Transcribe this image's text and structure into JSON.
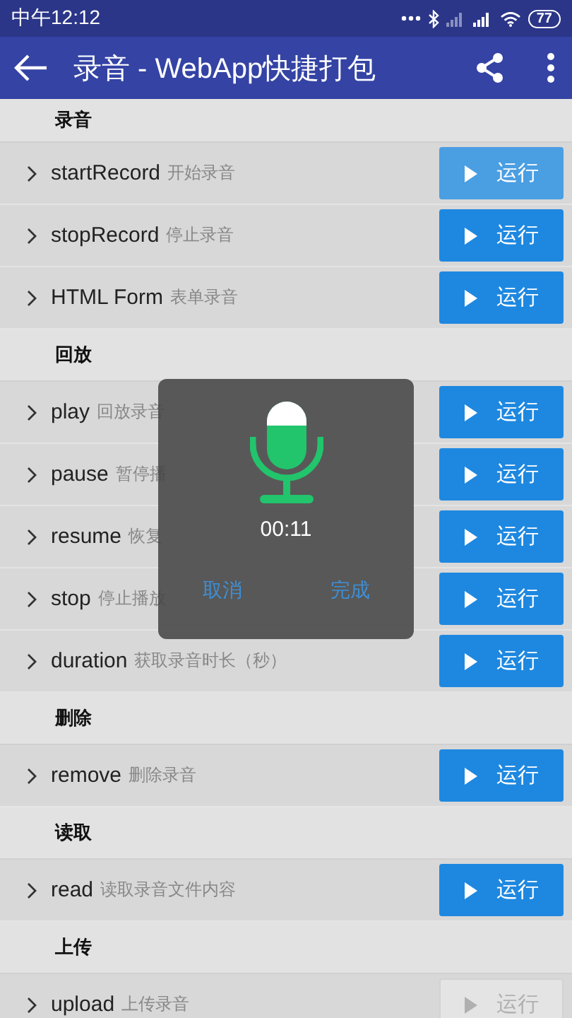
{
  "status_bar": {
    "time": "中午12:12",
    "battery": "77"
  },
  "app_bar": {
    "title": "录音 - WebApp快捷打包"
  },
  "sections": [
    {
      "title": "录音",
      "items": [
        {
          "name": "startRecord",
          "desc": "开始录音",
          "button": "运行",
          "pressed": true,
          "disabled": false
        },
        {
          "name": "stopRecord",
          "desc": "停止录音",
          "button": "运行",
          "pressed": false,
          "disabled": false
        },
        {
          "name": "HTML Form",
          "desc": "表单录音",
          "button": "运行",
          "pressed": false,
          "disabled": false
        }
      ]
    },
    {
      "title": "回放",
      "items": [
        {
          "name": "play",
          "desc": "回放录音",
          "button": "运行",
          "pressed": false,
          "disabled": false
        },
        {
          "name": "pause",
          "desc": "暂停播",
          "button": "运行",
          "pressed": false,
          "disabled": false
        },
        {
          "name": "resume",
          "desc": "恢复",
          "button": "运行",
          "pressed": false,
          "disabled": false
        },
        {
          "name": "stop",
          "desc": "停止播放",
          "button": "运行",
          "pressed": false,
          "disabled": false
        },
        {
          "name": "duration",
          "desc": "获取录音时长（秒）",
          "button": "运行",
          "pressed": false,
          "disabled": false
        }
      ]
    },
    {
      "title": "删除",
      "items": [
        {
          "name": "remove",
          "desc": "删除录音",
          "button": "运行",
          "pressed": false,
          "disabled": false
        }
      ]
    },
    {
      "title": "读取",
      "items": [
        {
          "name": "read",
          "desc": "读取录音文件内容",
          "button": "运行",
          "pressed": false,
          "disabled": false
        }
      ]
    },
    {
      "title": "上传",
      "items": [
        {
          "name": "upload",
          "desc": "上传录音",
          "button": "运行",
          "pressed": false,
          "disabled": true
        }
      ]
    }
  ],
  "dialog": {
    "time": "00:11",
    "cancel": "取消",
    "done": "完成"
  }
}
